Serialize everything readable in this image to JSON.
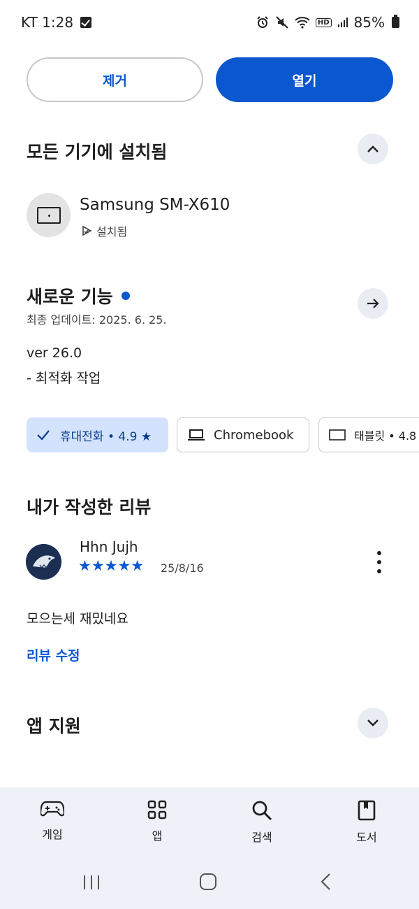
{
  "status_bar": {
    "carrier_time": "KT 1:28",
    "battery": "85%"
  },
  "actions": {
    "remove_label": "제거",
    "open_label": "열기"
  },
  "installed_section": {
    "title": "모든 기기에 설치됨",
    "device_name": "Samsung SM-X610",
    "device_status": "설치됨"
  },
  "whats_new": {
    "title": "새로운 기능",
    "updated": "최종 업데이트: 2025. 6. 25.",
    "version": "ver 26.0",
    "note": "- 최적화 작업"
  },
  "device_chips": [
    {
      "label": "휴대전화 • 4.9 ★"
    },
    {
      "label": "Chromebook"
    },
    {
      "label": "태블릿 • 4.8"
    }
  ],
  "my_review": {
    "title": "내가 작성한 리뷰",
    "author": "Hhn Jujh",
    "rating": 5,
    "stars": "★★★★★",
    "date": "25/8/16",
    "text": "모으는세 재밌네요",
    "edit_label": "리뷰 수정"
  },
  "app_support": {
    "title": "앱 지원"
  },
  "bottom_nav": [
    {
      "label": "게임",
      "icon": "gamepad-icon"
    },
    {
      "label": "앱",
      "icon": "apps-grid-icon"
    },
    {
      "label": "검색",
      "icon": "search-icon"
    },
    {
      "label": "도서",
      "icon": "book-icon"
    }
  ],
  "colors": {
    "accent": "#0b57d0",
    "chip_selected_bg": "#d3e3fd",
    "nav_bg": "#eef1f7"
  }
}
